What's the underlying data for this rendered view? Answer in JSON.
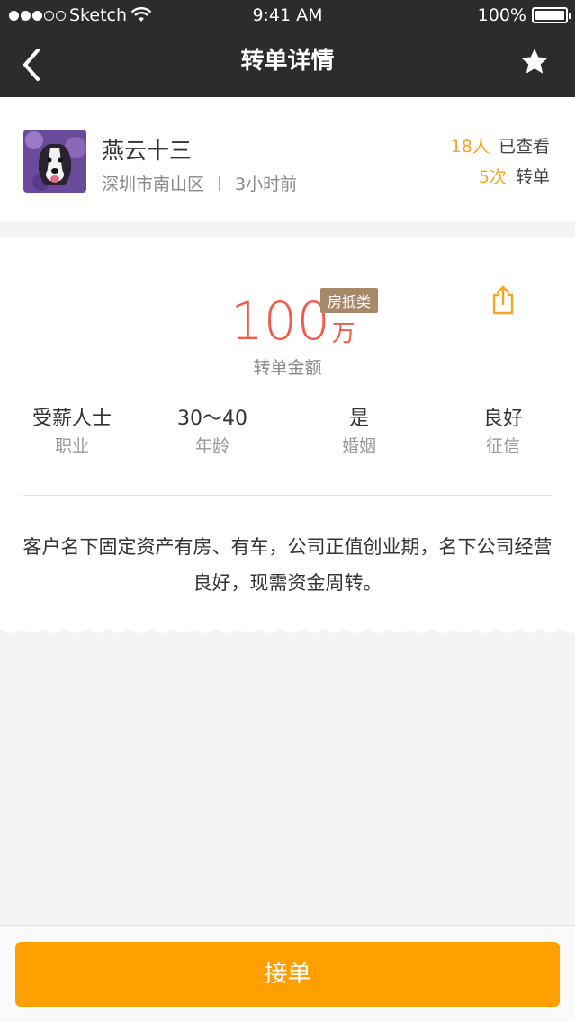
{
  "status_bar": {
    "carrier": "Sketch",
    "time": "9:41 AM",
    "battery": "100%"
  },
  "nav": {
    "title": "转单详情",
    "back_icon": "chevron-left-icon",
    "favorite_icon": "star-icon"
  },
  "user": {
    "name": "燕云十三",
    "location": "深圳市南山区",
    "time_ago": "3小时前",
    "views_count": "18人",
    "views_label": "已查看",
    "transfer_count": "5次",
    "transfer_label": "转单"
  },
  "deal": {
    "amount": "100",
    "unit": "万",
    "tag": "房抵类",
    "amount_label": "转单金额",
    "share_icon": "share-icon",
    "info": [
      {
        "value": "受薪人士",
        "label": "职业"
      },
      {
        "value": "30～40",
        "label": "年龄"
      },
      {
        "value": "是",
        "label": "婚姻"
      },
      {
        "value": "良好",
        "label": "征信"
      }
    ],
    "description": "客户名下固定资产有房、有车，公司正值创业期，名下公司经营良好，现需资金周转。"
  },
  "action": {
    "accept_label": "接单"
  },
  "colors": {
    "nav_bg": "#2c2c2c",
    "accent_orange": "#ffa000",
    "amount_red": "#f25b4a",
    "tag_brown": "#a7896a",
    "stat_orange": "#f5a623"
  }
}
